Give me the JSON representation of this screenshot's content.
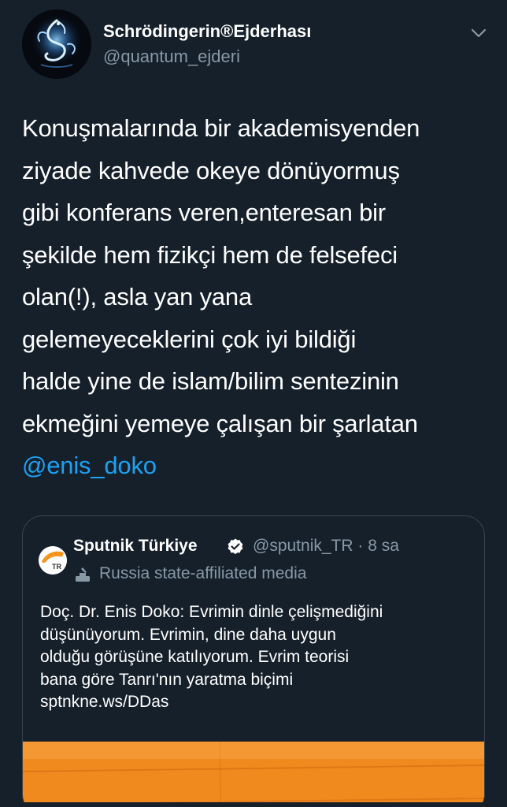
{
  "tweet": {
    "author": {
      "display_name": "Schrödingerin®Ejderhası",
      "handle": "@quantum_ejderi"
    },
    "text_lines": [
      "Konuşmalarında bir akademisyenden",
      "ziyade kahvede okeye dönüyormuş",
      "gibi konferans veren,enteresan bir",
      "şekilde hem fizikçi hem de felsefeci",
      "olan(!), asla yan yana",
      "gelemeyeceklerini çok iyi bildiği",
      "halde yine de islam/bilim sentezinin",
      "ekmeğini yemeye çalışan bir şarlatan"
    ],
    "mention": "@enis_doko",
    "menu_icon": "chevron-down-icon"
  },
  "quoted_tweet": {
    "author": {
      "display_name": "Sputnik Türkiye",
      "meta": "@sputnik_TR · 8 sa",
      "avatar_text": "TR"
    },
    "label": "Russia state-affiliated media",
    "text_lines": [
      "Doç. Dr. Enis Doko: Evrimin dinle çelişmediğini",
      "düşünüyorum. Evrimin, dine daha uygun",
      "olduğu görüşüne katılıyorum. Evrim teorisi",
      "bana göre Tanrı'nın yaratma biçimi"
    ],
    "link": "sptnkne.ws/DDas"
  },
  "colors": {
    "background": "#15202b",
    "text": "#ffffff",
    "secondary_text": "#8899a6",
    "link": "#1da1f2",
    "border": "#38444d",
    "media_orange": "#f08a1f"
  }
}
